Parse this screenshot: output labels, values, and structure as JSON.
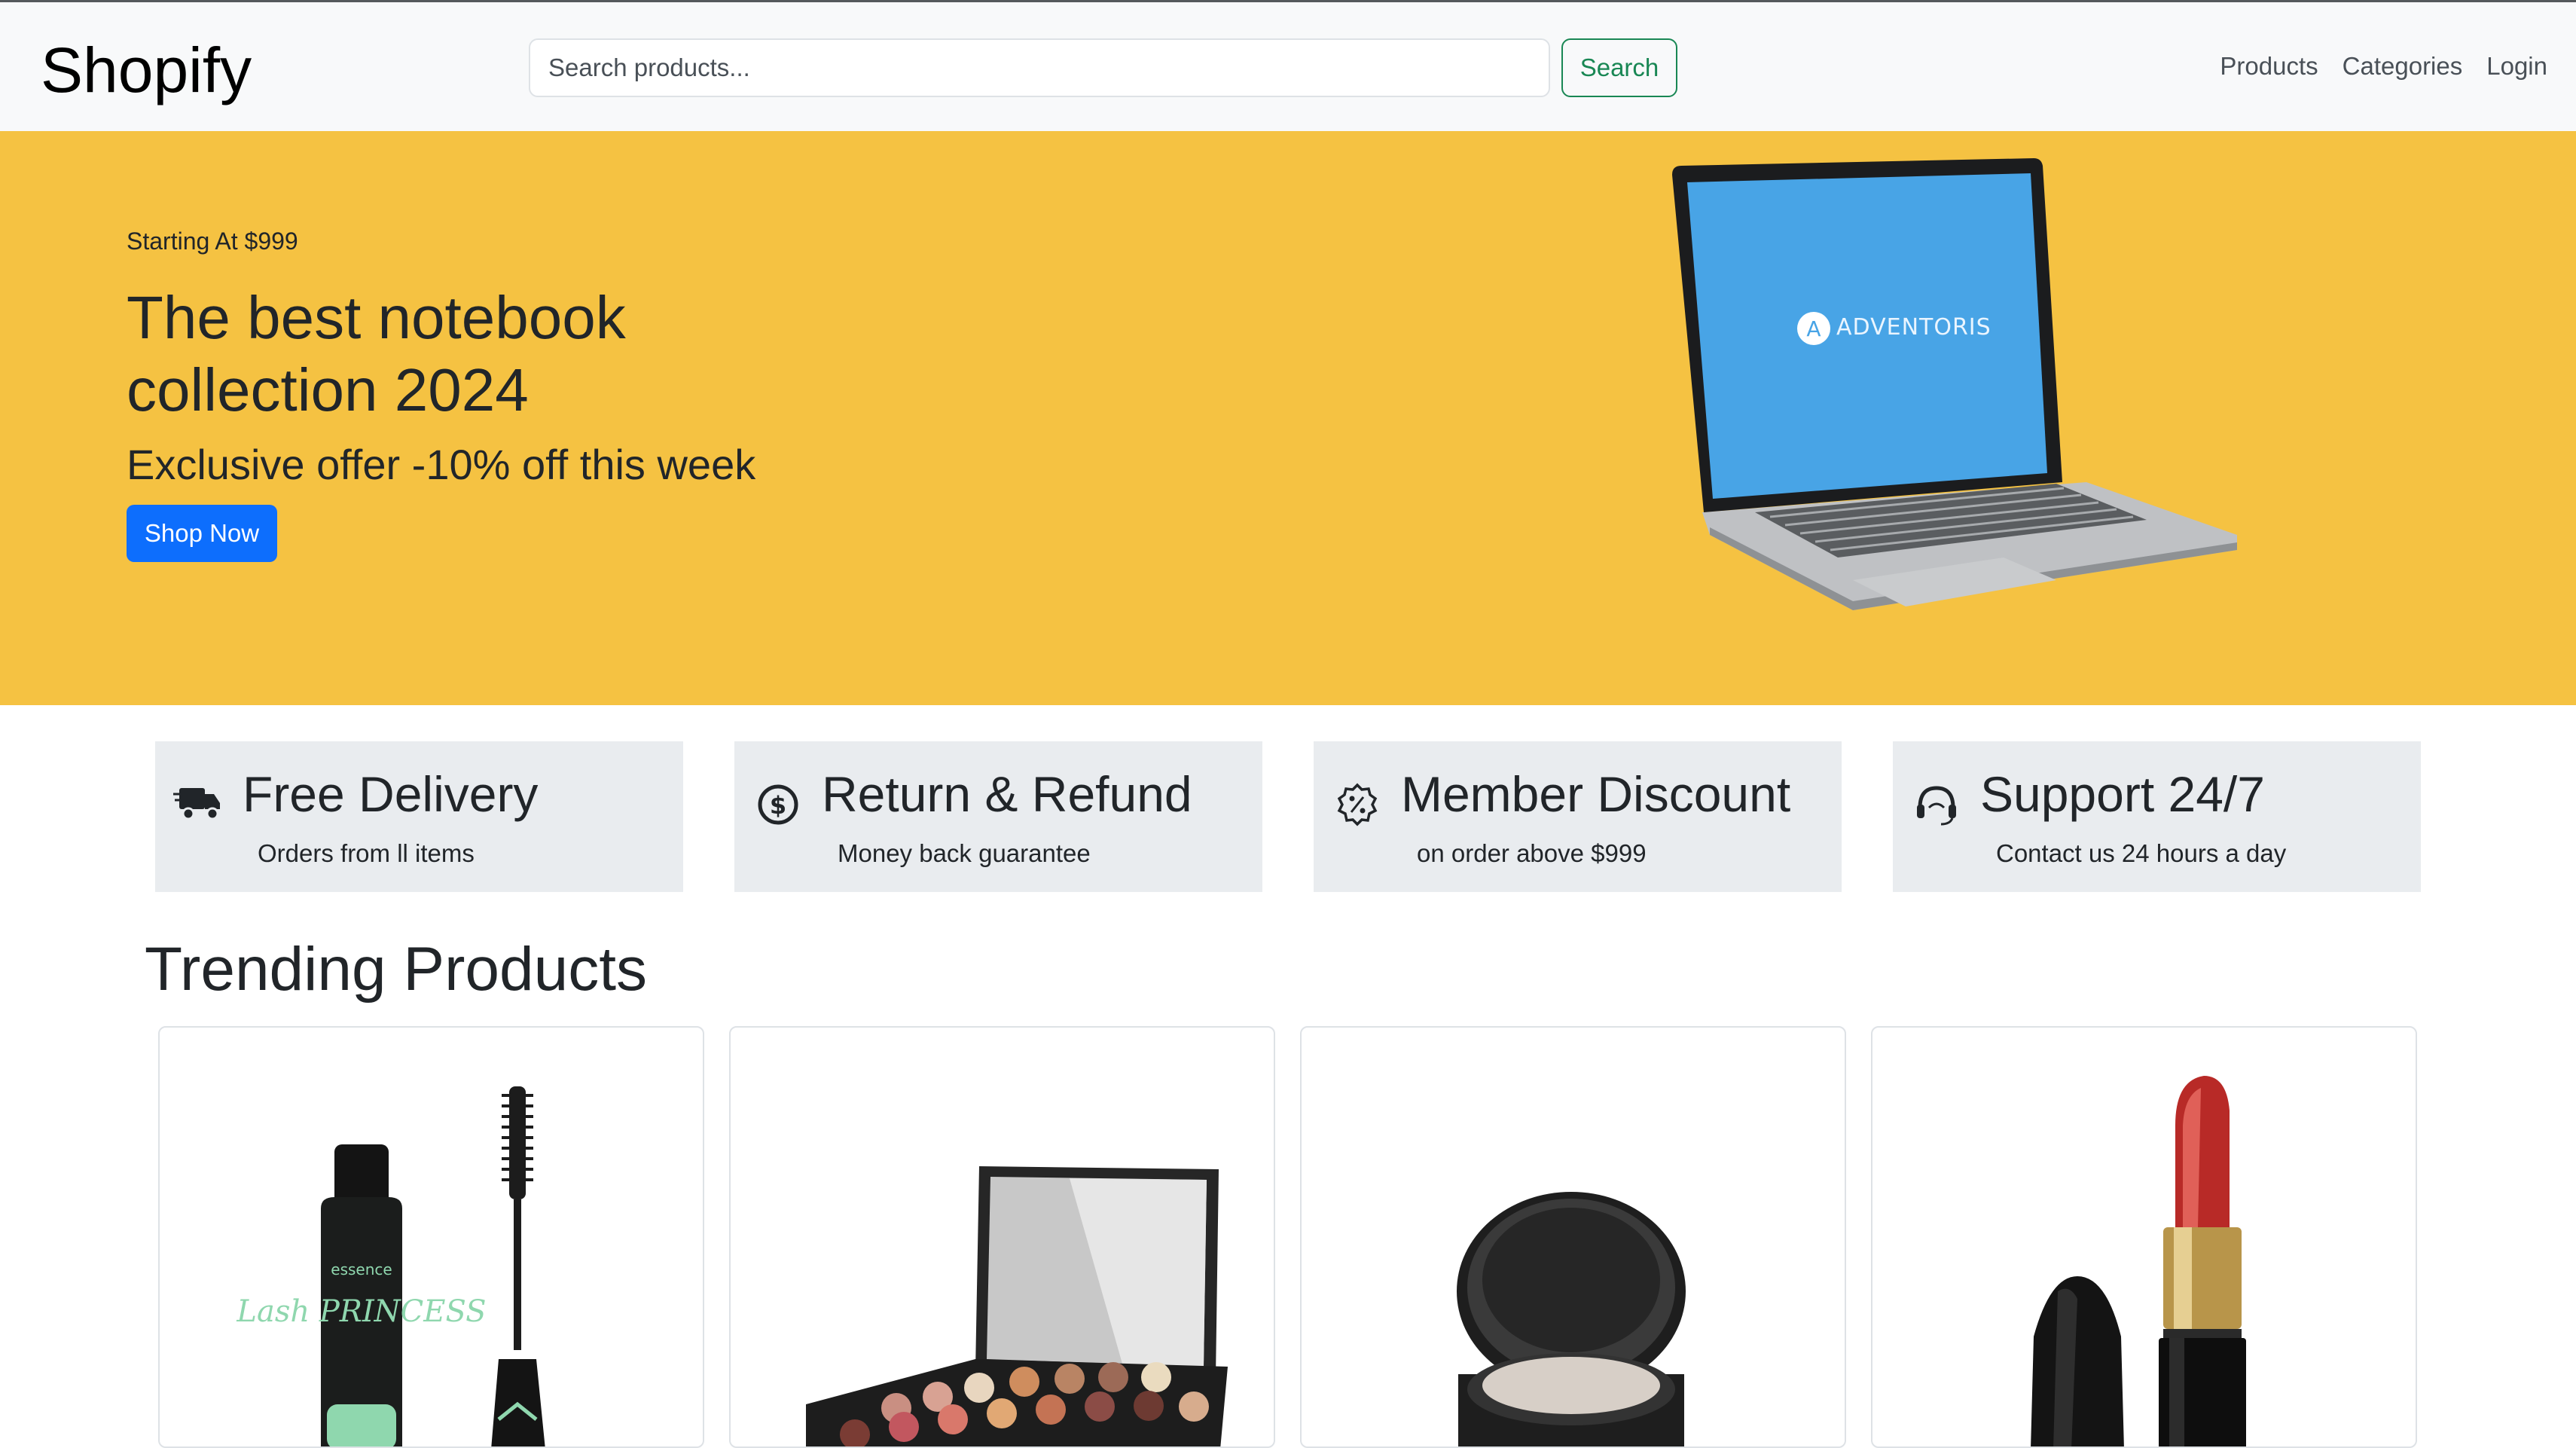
{
  "navbar": {
    "brand": "Shopify",
    "search_placeholder": "Search products...",
    "search_button": "Search",
    "links": [
      "Products",
      "Categories",
      "Login"
    ]
  },
  "hero": {
    "kicker": "Starting At $999",
    "title": "The best notebook collection 2024",
    "subtitle": "Exclusive offer -10% off this week",
    "cta": "Shop Now",
    "laptop_brand": "ADVENTORIS",
    "bg_color": "#f5c242"
  },
  "features": [
    {
      "title": "Free Delivery",
      "subtitle": "Orders from ll items",
      "icon": "truck-icon"
    },
    {
      "title": "Return & Refund",
      "subtitle": "Money back guarantee",
      "icon": "dollar-circle-icon"
    },
    {
      "title": "Member Discount",
      "subtitle": "on order above $999",
      "icon": "percent-badge-icon"
    },
    {
      "title": "Support 24/7",
      "subtitle": "Contact us 24 hours a day",
      "icon": "headset-icon"
    }
  ],
  "trending": {
    "title": "Trending Products",
    "products": [
      {
        "image": "mascara",
        "brand_text": "essence",
        "product_text": "Lash PRINCESS"
      },
      {
        "image": "eyeshadow-palette"
      },
      {
        "image": "powder-compact"
      },
      {
        "image": "lipstick"
      }
    ]
  },
  "colors": {
    "primary": "#0d6efd",
    "success": "#198754",
    "navbar_bg": "#f8f9fa",
    "feature_bg": "#e9ecef"
  }
}
